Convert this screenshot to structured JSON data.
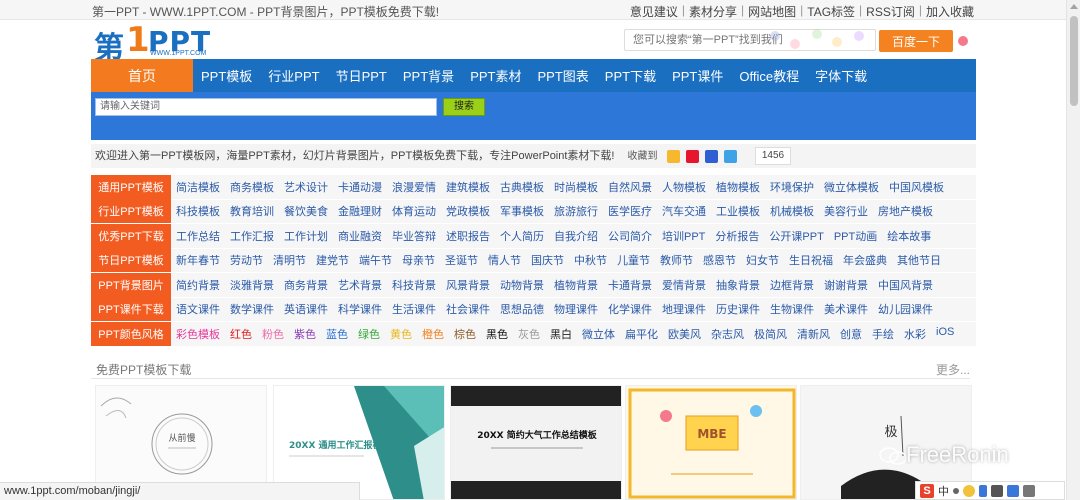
{
  "topbar": {
    "site_title": "第一PPT - WWW.1PPT.COM - PPT背景图片，PPT模板免费下载!",
    "links": [
      "意见建议",
      "素材分享",
      "网站地图",
      "TAG标签",
      "RSS订阅",
      "加入收藏"
    ]
  },
  "header": {
    "logo_chinese": "第",
    "logo_number": "1",
    "logo_text": "PPT",
    "logo_url": "WWW.1PPT.COM",
    "search_placeholder": "您可以搜索“第一PPT”找到我们",
    "search_button": "百度一下"
  },
  "nav": {
    "home": "首页",
    "items": [
      "PPT模板",
      "行业PPT",
      "节日PPT",
      "PPT背景",
      "PPT素材",
      "PPT图表",
      "PPT下载",
      "PPT课件",
      "Office教程",
      "字体下载"
    ]
  },
  "keyword_search": {
    "placeholder": "请输入关键词",
    "button": "搜索"
  },
  "welcome": {
    "text": "欢迎进入第一PPT模板网，海量PPT素材，幻灯片背景图片，PPT模板免费下载，专注PowerPoint素材下载!",
    "fav_label": "收藏到",
    "count": "1456"
  },
  "categories": [
    {
      "label": "通用PPT模板",
      "links": [
        "简洁模板",
        "商务模板",
        "艺术设计",
        "卡通动漫",
        "浪漫爱情",
        "建筑模板",
        "古典模板",
        "时尚模板",
        "自然风景",
        "人物模板",
        "植物模板",
        "环境保护",
        "微立体模板",
        "中国风模板"
      ]
    },
    {
      "label": "行业PPT模板",
      "links": [
        "科技模板",
        "教育培训",
        "餐饮美食",
        "金融理财",
        "体育运动",
        "党政模板",
        "军事模板",
        "旅游旅行",
        "医学医疗",
        "汽车交通",
        "工业模板",
        "机械模板",
        "美容行业",
        "房地产模板"
      ]
    },
    {
      "label": "优秀PPT下载",
      "links": [
        "工作总结",
        "工作汇报",
        "工作计划",
        "商业融资",
        "毕业答辩",
        "述职报告",
        "个人简历",
        "自我介绍",
        "公司简介",
        "培训PPT",
        "分析报告",
        "公开课PPT",
        "PPT动画",
        "绘本故事"
      ]
    },
    {
      "label": "节日PPT模板",
      "links": [
        "新年春节",
        "劳动节",
        "清明节",
        "建党节",
        "端午节",
        "母亲节",
        "圣诞节",
        "情人节",
        "国庆节",
        "中秋节",
        "儿童节",
        "教师节",
        "感恩节",
        "妇女节",
        "生日祝福",
        "年会盛典",
        "其他节日"
      ]
    },
    {
      "label": "PPT背景图片",
      "links": [
        "简约背景",
        "淡雅背景",
        "商务背景",
        "艺术背景",
        "科技背景",
        "风景背景",
        "动物背景",
        "植物背景",
        "卡通背景",
        "爱情背景",
        "抽象背景",
        "边框背景",
        "谢谢背景",
        "中国风背景"
      ]
    },
    {
      "label": "PPT课件下载",
      "links": [
        "语文课件",
        "数学课件",
        "英语课件",
        "科学课件",
        "生活课件",
        "社会课件",
        "思想品德",
        "物理课件",
        "化学课件",
        "地理课件",
        "历史课件",
        "生物课件",
        "美术课件",
        "幼儿园课件"
      ]
    },
    {
      "label": "PPT颜色风格",
      "links": [
        "彩色模板",
        "红色",
        "粉色",
        "紫色",
        "蓝色",
        "绿色",
        "黄色",
        "橙色",
        "棕色",
        "黑色",
        "灰色",
        "黑白",
        "微立体",
        "扁平化",
        "欧美风",
        "杂志风",
        "极简风",
        "清新风",
        "创意",
        "手绘",
        "水彩",
        "iOS"
      ]
    }
  ],
  "color_style_colors": [
    "#e6399b",
    "#e02020",
    "#f06aa8",
    "#8a3fb5",
    "#2a6fd6",
    "#36a83a",
    "#e8b71c",
    "#f2801f",
    "#8a5a2b",
    "#111111",
    "#999999",
    "#222222"
  ],
  "section": {
    "title": "免费PPT模板下载",
    "more": "更多..."
  },
  "thumbnails": [
    {
      "text": "从前慢"
    },
    {
      "text": "20XX 通用工作汇报模板"
    },
    {
      "text": "20XX 简约大气工作总结模板"
    },
    {
      "text": "MBE"
    },
    {
      "text": "极"
    }
  ],
  "statusbar": {
    "url": "www.1ppt.com/moban/jingji/"
  },
  "watermark": {
    "text": "FreeRonin"
  },
  "ime": {
    "label": "中"
  }
}
